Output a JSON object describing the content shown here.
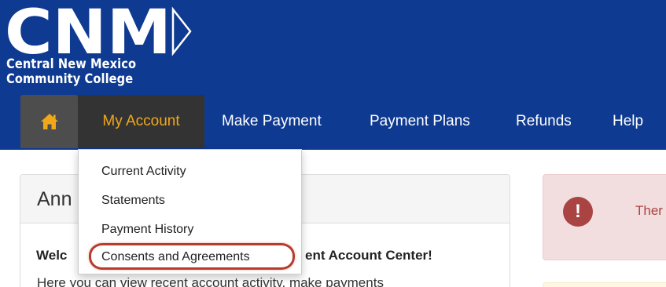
{
  "brand": {
    "logo_text": "CNM",
    "name_line1": "Central New Mexico",
    "name_line2": "Community College"
  },
  "nav": {
    "home_icon": "home-icon",
    "items": [
      {
        "label": "My Account",
        "active": true
      },
      {
        "label": "Make Payment"
      },
      {
        "label": "Payment Plans"
      },
      {
        "label": "Refunds"
      },
      {
        "label": "Help"
      }
    ]
  },
  "dropdown": {
    "items": [
      {
        "label": "Current Activity"
      },
      {
        "label": "Statements"
      },
      {
        "label": "Payment History"
      },
      {
        "label": "Consents and Agreements",
        "highlighted": true
      }
    ]
  },
  "panel": {
    "title": "Ann",
    "welcome_left": "Welc",
    "welcome_right": "ent Account Center!",
    "body": "Here you can view recent account activity, make payments"
  },
  "alert": {
    "icon": "exclamation-icon",
    "icon_glyph": "!",
    "text": "Ther"
  },
  "colors": {
    "header_bg": "#0e3a91",
    "active_nav_text": "#f0a81a",
    "highlight_ring": "#b83c2c",
    "alert_bg": "#f2dede",
    "alert_text": "#a94442"
  }
}
